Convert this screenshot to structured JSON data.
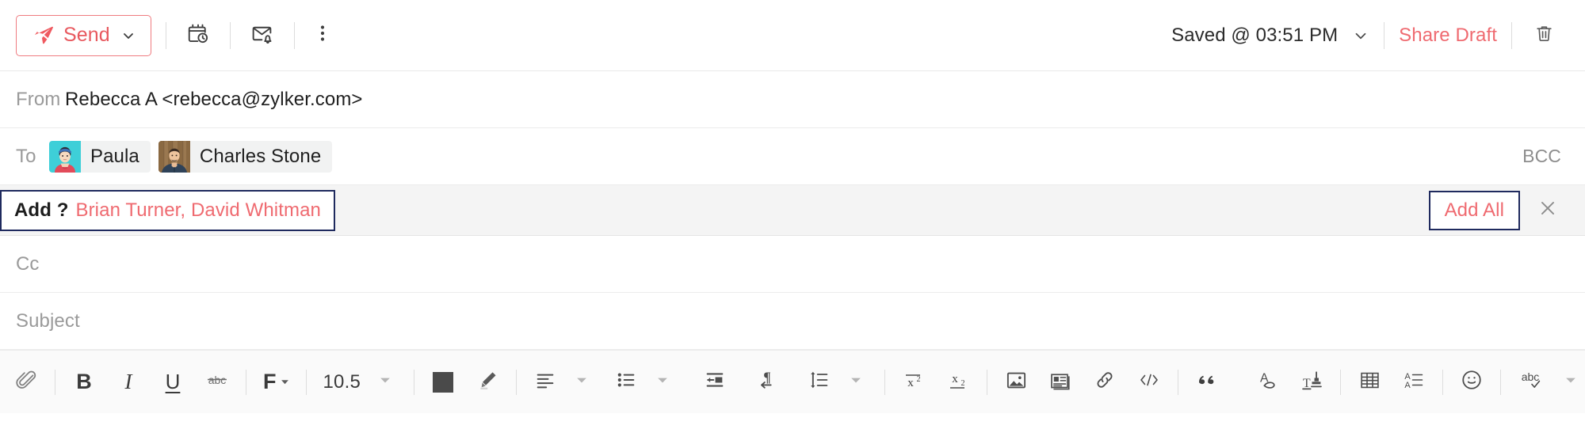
{
  "topbar": {
    "send_label": "Send",
    "send_icon": "paper-plane-icon",
    "send_chevron_icon": "chevron-down-icon",
    "schedule_icon": "calendar-clock-icon",
    "reminder_icon": "envelope-bell-icon",
    "more_icon": "more-vertical-icon",
    "saved_status": "Saved @ 03:51 PM",
    "saved_chevron_icon": "chevron-down-icon",
    "share_draft_label": "Share Draft",
    "delete_icon": "trash-icon",
    "accent_color": "#ef6a70",
    "send_border_color": "#ef7b80"
  },
  "fields": {
    "from_label": "From",
    "from_value": "Rebecca A <rebecca@zylker.com>",
    "to_label": "To",
    "to_recipients": [
      {
        "name": "Paula",
        "avatar": "avatar-paula",
        "avatar_bg": "#3ecfd8"
      },
      {
        "name": "Charles Stone",
        "avatar": "avatar-charles-stone",
        "avatar_bg": "#8a6a4a"
      }
    ],
    "bcc_label": "BCC",
    "cc_placeholder": "Cc",
    "subject_placeholder": "Subject"
  },
  "suggestion": {
    "add_label": "Add ?",
    "names": "Brian Turner, David Whitman",
    "add_all_label": "Add All",
    "close_icon": "close-icon",
    "focus_border_color": "#1f2a5e",
    "bar_background": "#f4f4f4"
  },
  "formatbar": {
    "items": [
      {
        "name": "attach-icon",
        "label": ""
      },
      {
        "name": "bold-button",
        "label": "B"
      },
      {
        "name": "italic-button",
        "label": "I"
      },
      {
        "name": "underline-button",
        "label": "U"
      },
      {
        "name": "strikethrough-button",
        "label": "abc"
      },
      {
        "name": "font-family-button",
        "label": "F"
      },
      {
        "name": "font-size-button",
        "label": "10.5"
      },
      {
        "name": "text-color-button",
        "label": ""
      },
      {
        "name": "highlight-button",
        "label": ""
      },
      {
        "name": "align-left-button",
        "label": ""
      },
      {
        "name": "bullet-list-button",
        "label": ""
      },
      {
        "name": "indent-button",
        "label": ""
      },
      {
        "name": "text-direction-button",
        "label": ""
      },
      {
        "name": "line-spacing-button",
        "label": ""
      },
      {
        "name": "superscript-button",
        "label": ""
      },
      {
        "name": "subscript-button",
        "label": ""
      },
      {
        "name": "insert-image-button",
        "label": ""
      },
      {
        "name": "insert-card-button",
        "label": ""
      },
      {
        "name": "insert-link-button",
        "label": ""
      },
      {
        "name": "code-button",
        "label": ""
      },
      {
        "name": "blockquote-button",
        "label": ""
      },
      {
        "name": "clear-formatting-button",
        "label": ""
      },
      {
        "name": "remove-format-button",
        "label": ""
      },
      {
        "name": "insert-table-button",
        "label": ""
      },
      {
        "name": "text-styles-button",
        "label": ""
      },
      {
        "name": "emoji-button",
        "label": ""
      },
      {
        "name": "spellcheck-button",
        "label": "abc"
      },
      {
        "name": "expand-toolbar-button",
        "label": ""
      }
    ],
    "font_size_value": "10.5",
    "font_family_letter": "F",
    "strikethrough_letter": "abc",
    "bold_letter": "B",
    "italic_letter": "I",
    "underline_letter": "U",
    "spellcheck_letter": "abc",
    "text_color_swatch": "#4a4a4a"
  }
}
